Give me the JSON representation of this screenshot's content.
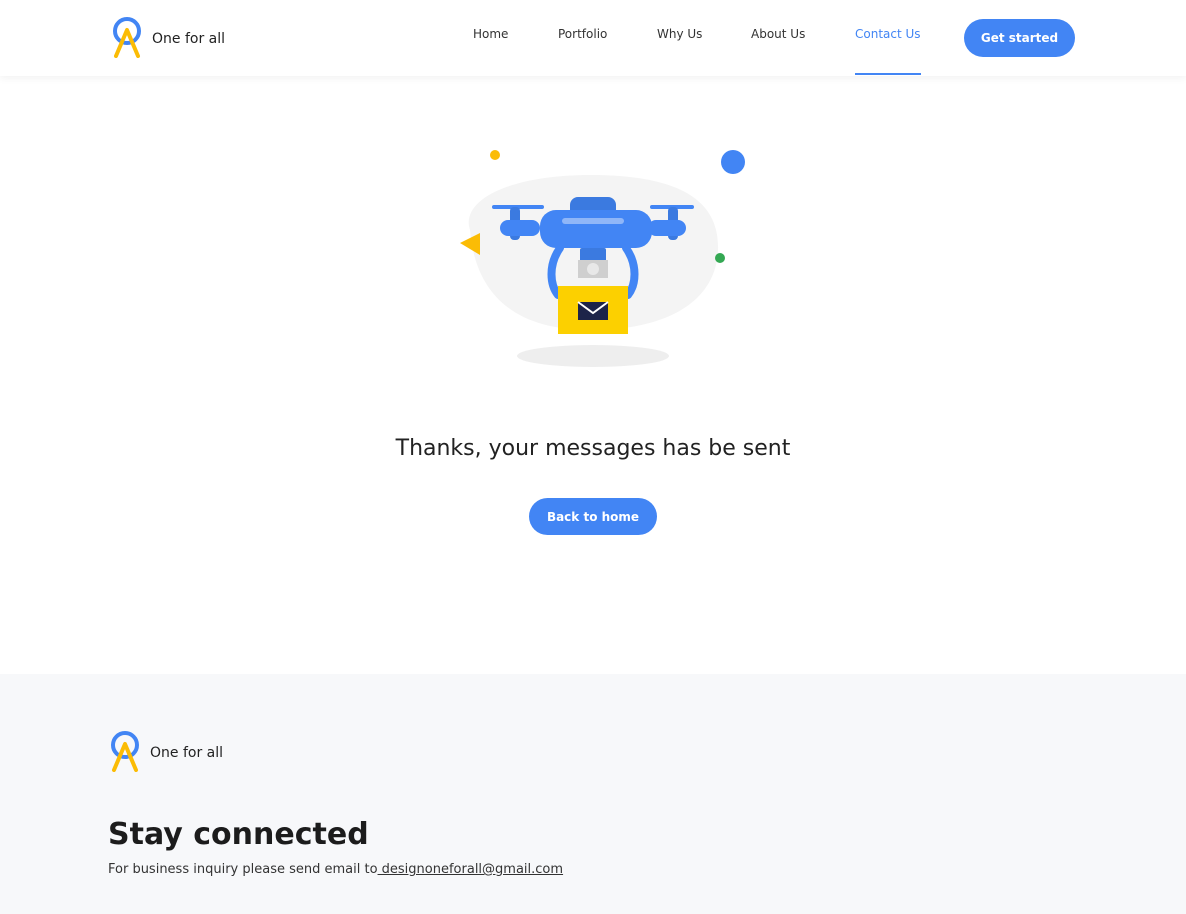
{
  "header": {
    "brand": "One for all",
    "nav": [
      {
        "label": "Home"
      },
      {
        "label": "Portfolio"
      },
      {
        "label": "Why Us"
      },
      {
        "label": "About Us"
      },
      {
        "label": "Contact Us",
        "active": true
      }
    ],
    "cta_label": "Get started"
  },
  "main": {
    "illustration_icon": "drone-delivering-mail-icon",
    "message": "Thanks, your messages has be sent",
    "back_label": "Back to home"
  },
  "footer": {
    "brand": "One for all",
    "title": "Stay connected",
    "inquiry_text": "For business inquiry please send email to",
    "email": " designoneforall@gmail.com"
  },
  "colors": {
    "accent": "#4285f4",
    "yellow": "#fbbc05",
    "green": "#34a853",
    "footer_bg": "#f7f8fa"
  }
}
